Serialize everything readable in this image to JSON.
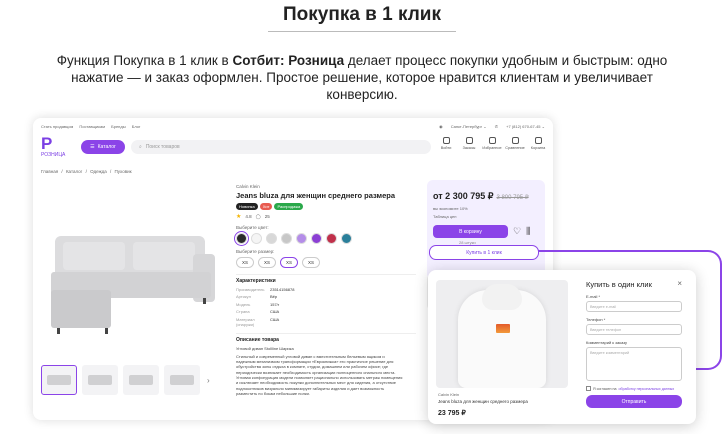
{
  "slide": {
    "title": "Покупка в 1 клик",
    "desc_pre": "Функция Покупка в 1 клик в ",
    "desc_bold": "Сотбит: Розница",
    "desc_post": " делает процесс покупки удобным и быстрым: одно нажатие — и заказ оформлен. Простое решение, которое нравится клиентам и увеличивает конверсию."
  },
  "topbar": {
    "links": [
      "Стать продавцом",
      "Поставщикам",
      "Бренды",
      "Блог"
    ],
    "city": "Санкт-Петербург",
    "phone": "+7 (812) 670-67-45"
  },
  "header": {
    "logo_word": "РОЗНИЦА",
    "catalog_label": "Каталог",
    "search_placeholder": "Поиск товаров",
    "icons": [
      {
        "label": "Войти",
        "icon": "user-icon"
      },
      {
        "label": "Заказы",
        "icon": "orders-icon"
      },
      {
        "label": "Избранное",
        "icon": "heart-icon"
      },
      {
        "label": "Сравнение",
        "icon": "compare-icon"
      },
      {
        "label": "Корзина",
        "icon": "cart-icon"
      }
    ]
  },
  "breadcrumbs": [
    "Главная",
    "/",
    "Каталог",
    "/",
    "Одежда",
    "/",
    "Пуховик"
  ],
  "product": {
    "brand": "Calvin Klein",
    "title": "Jeans bluza для женщин среднего размера",
    "badges": [
      {
        "label": "Новинка",
        "color": "#222222"
      },
      {
        "label": "Хит",
        "color": "#e85a4f"
      },
      {
        "label": "Распродажа",
        "color": "#2aa84a"
      }
    ],
    "rating": "4.8",
    "reviews": "25",
    "color_label": "Выберите цвет:",
    "colors": [
      "#2b2b2b",
      "#f5f5f5",
      "#d8d8d8",
      "#c7c7c7",
      "#b48de8",
      "#8b3fd4",
      "#c0304a",
      "#2a7f9a"
    ],
    "size_label": "Выберите размер:",
    "sizes": [
      "XS",
      "XS",
      "XS",
      "XS"
    ],
    "specs_title": "Характеристики",
    "specs": [
      {
        "k": "Производитель",
        "v": "23514156878"
      },
      {
        "k": "Артикул",
        "v": "Вёр"
      },
      {
        "k": "Модель",
        "v": "157/г"
      },
      {
        "k": "Страна",
        "v": "США"
      },
      {
        "k": "Материал (снаружи)",
        "v": "США"
      }
    ],
    "desc_title": "Описание товара",
    "desc_head": "Угловой диван Stollline Шарика",
    "desc_body": "Стильный и современный угловой диван с вместительным бельевым ящиком и надежным механизмом трансформации «Еврокнижка» это практичное решение для обустройства зоны отдыха в комнате, студии, домашнем или рабочем офисе; где периодически возникает необходимость организации полноценного спального места. Угловая конфигурация модели позволяет рационально использовать метраж помещения и исключает необходимость покупки дополнительных мест для сидения, а отсутствие подлокотников визуально минимизирует габариты изделия и дает возможность разместить по бокам небольшие полки."
  },
  "price": {
    "current": "от 2 300 795 ₽",
    "old": "3 800 795 ₽",
    "save": "вы экономите 10%",
    "credit": "Таблица цен",
    "cart_label": "В корзину",
    "in_stock": "28 штуки",
    "one_click_label": "Купить в 1 клик"
  },
  "modal": {
    "title": "Купить в один клик",
    "brand": "Calvin Klein",
    "name": "Jeans bluza для женщин среднего размера",
    "price": "23 795 ₽",
    "email_label": "E-mail *",
    "email_placeholder": "Введите e-mail",
    "phone_label": "Телефон *",
    "phone_placeholder": "Введите телефон",
    "comment_label": "Комментарий к заказу",
    "comment_placeholder": "Введите комментарий",
    "agree_pre": "Я согласен на",
    "agree_link": "обработку персональных данных",
    "submit_label": "Отправить"
  }
}
